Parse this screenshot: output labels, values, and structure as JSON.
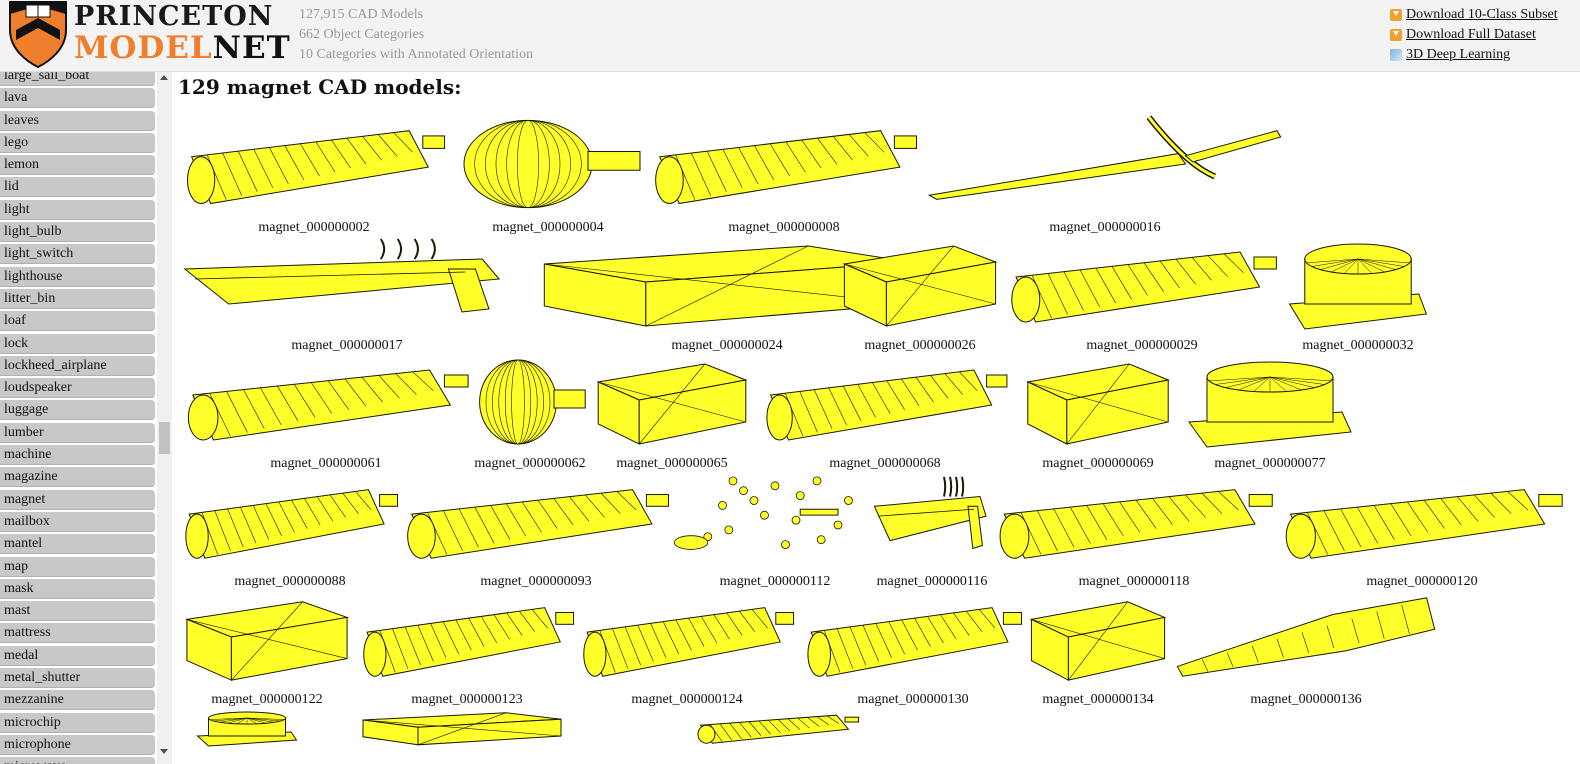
{
  "header": {
    "brand_line1": "PRINCETON",
    "brand_line2_a": "MODEL",
    "brand_line2_b": "NET",
    "stats": [
      "127,915 CAD Models",
      "662 Object Categories",
      "10 Categories with Annotated Orientation"
    ],
    "links": [
      {
        "label": "Download 10-Class Subset",
        "icon": "download-icon"
      },
      {
        "label": "Download Full Dataset",
        "icon": "download-icon"
      },
      {
        "label": "3D Deep Learning",
        "icon": "deep-learning-icon"
      }
    ]
  },
  "sidebar": {
    "categories": [
      "large_sail_boat",
      "lava",
      "leaves",
      "lego",
      "lemon",
      "lid",
      "light",
      "light_bulb",
      "light_switch",
      "lighthouse",
      "litter_bin",
      "loaf",
      "lock",
      "lockheed_airplane",
      "loudspeaker",
      "luggage",
      "lumber",
      "machine",
      "magazine",
      "magnet",
      "mailbox",
      "mantel",
      "map",
      "mask",
      "mast",
      "mattress",
      "medal",
      "metal_shutter",
      "mezzanine",
      "microchip",
      "microphone",
      "microwave"
    ]
  },
  "main": {
    "title": "129 magnet CAD models:",
    "models": [
      {
        "label": "magnet_000000002",
        "shape": "cylinder"
      },
      {
        "label": "magnet_000000004",
        "shape": "bulb"
      },
      {
        "label": "magnet_000000008",
        "shape": "cylinder"
      },
      {
        "label": "magnet_000000016",
        "shape": "sword"
      },
      {
        "label": "magnet_000000017",
        "shape": "gun"
      },
      {
        "label": "magnet_000000024",
        "shape": "box"
      },
      {
        "label": "magnet_000000026",
        "shape": "box"
      },
      {
        "label": "magnet_000000029",
        "shape": "cylinder"
      },
      {
        "label": "magnet_000000032",
        "shape": "puck"
      },
      {
        "label": "magnet_000000061",
        "shape": "cylinder"
      },
      {
        "label": "magnet_000000062",
        "shape": "bulb"
      },
      {
        "label": "magnet_000000065",
        "shape": "box"
      },
      {
        "label": "magnet_000000068",
        "shape": "cylinder"
      },
      {
        "label": "magnet_000000069",
        "shape": "box"
      },
      {
        "label": "magnet_000000077",
        "shape": "puck"
      },
      {
        "label": "magnet_000000088",
        "shape": "cylinder"
      },
      {
        "label": "magnet_000000093",
        "shape": "cylinder"
      },
      {
        "label": "magnet_000000112",
        "shape": "scatter"
      },
      {
        "label": "magnet_000000116",
        "shape": "gun"
      },
      {
        "label": "magnet_000000118",
        "shape": "cylinder"
      },
      {
        "label": "magnet_000000120",
        "shape": "cylinder"
      },
      {
        "label": "magnet_000000122",
        "shape": "box"
      },
      {
        "label": "magnet_000000123",
        "shape": "cylinder"
      },
      {
        "label": "magnet_000000124",
        "shape": "cylinder"
      },
      {
        "label": "magnet_000000130",
        "shape": "cylinder"
      },
      {
        "label": "magnet_000000134",
        "shape": "box"
      },
      {
        "label": "magnet_000000136",
        "shape": "cone"
      },
      {
        "label": "",
        "shape": "puck"
      },
      {
        "label": "",
        "shape": "box"
      },
      {
        "label": "",
        "shape": "cylinder"
      }
    ]
  },
  "colors": {
    "model_fill": "#ffff2a",
    "model_stroke": "#1a1a00",
    "shield_orange": "#ee7f2d",
    "sidebar_item": "#c8c8c8"
  }
}
